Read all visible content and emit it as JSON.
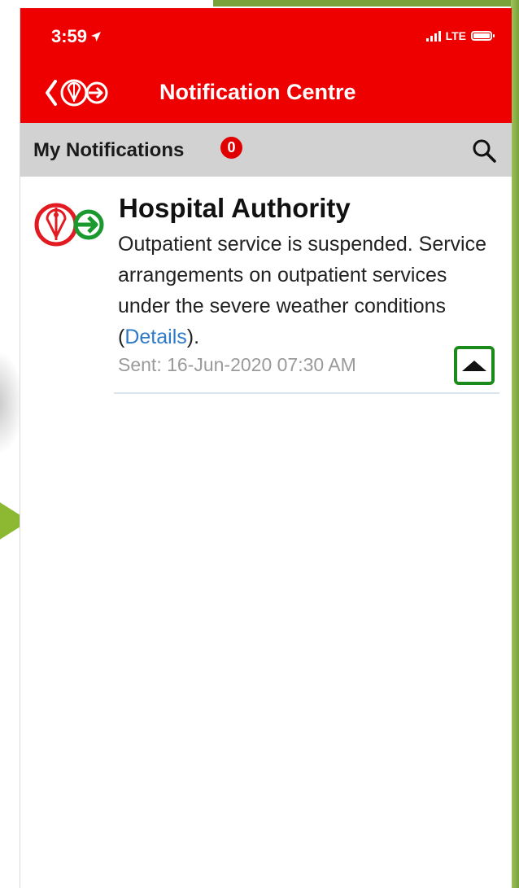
{
  "status_bar": {
    "time": "3:59",
    "network": "LTE"
  },
  "header": {
    "title": "Notification Centre"
  },
  "section": {
    "title": "My Notifications",
    "unread_count": "0"
  },
  "notifications": [
    {
      "sender": "Hospital Authority",
      "message_prefix": "Outpatient service is suspended. Service arrangements on outpatient services under the severe weather conditions (",
      "link_text": "Details",
      "message_suffix": ").",
      "sent": "Sent: 16-Jun-2020 07:30 AM"
    }
  ],
  "icons": {
    "back": "chevron-left-icon",
    "logo": "hospital-authority-logo",
    "search": "search-icon",
    "collapse": "collapse-up-icon",
    "location": "location-arrow-icon"
  },
  "colors": {
    "header_bg": "#ee0000",
    "section_bg": "#d2d2d2",
    "badge": "#e00000",
    "link": "#2f7ac6",
    "highlight": "#1a8a1a"
  }
}
